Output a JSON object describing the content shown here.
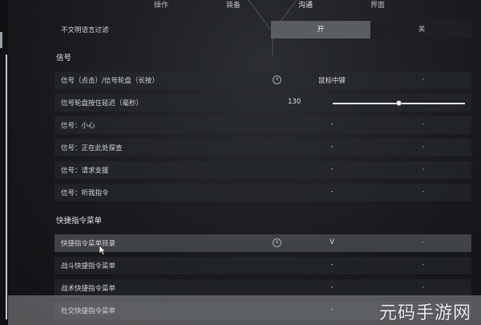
{
  "tabs": [
    {
      "label": "操作",
      "active": false
    },
    {
      "label": "装备",
      "active": false
    },
    {
      "label": "沟通",
      "active": true
    },
    {
      "label": "界面",
      "active": false
    }
  ],
  "profanity_filter": {
    "label": "不文明语言过滤",
    "on_label": "开",
    "off_label": "关",
    "selected": "开"
  },
  "sections": {
    "signal": "信号",
    "quick_menu": "快捷指令菜单"
  },
  "signal_rows": [
    {
      "label": "信号（点击）/信号轮盘（长按）",
      "primary": "鼠标中键",
      "secondary": "-",
      "clearable": true
    },
    {
      "label": "信号：小心",
      "primary": "-",
      "secondary": "-"
    },
    {
      "label": "信号：正在此处探查",
      "primary": "-",
      "secondary": "-"
    },
    {
      "label": "信号：请求支援",
      "primary": "-",
      "secondary": "-"
    },
    {
      "label": "信号：听我指令",
      "primary": "-",
      "secondary": "-"
    }
  ],
  "delay_slider": {
    "label": "信号轮盘按住延迟（毫秒）",
    "value": "130",
    "fraction": 0.5
  },
  "quick_rows": [
    {
      "label": "快捷指令菜单目录",
      "primary": "V",
      "secondary": "-",
      "clearable": true,
      "highlighted": true
    },
    {
      "label": "战斗快捷指令菜单",
      "primary": "-",
      "secondary": "-"
    },
    {
      "label": "战术快捷指令菜单",
      "primary": "-",
      "secondary": "-"
    },
    {
      "label": "社交快捷指令菜单",
      "primary": "-",
      "secondary": "-"
    }
  ],
  "clear_icon": "circle-x-icon",
  "watermark": "元码手游网",
  "colors": {
    "accent_on": "#5a5e63",
    "background": "#16181b"
  }
}
